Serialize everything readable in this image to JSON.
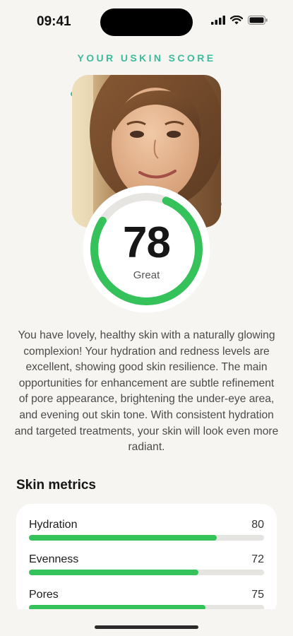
{
  "status_bar": {
    "time": "09:41"
  },
  "screen_title": "YOUR USKIN SCORE",
  "score": {
    "value": "78",
    "label": "Great",
    "progress": 0.78,
    "ring_color": "#36c25a"
  },
  "summary": "You have lovely, healthy skin with a naturally glowing complexion! Your hydration and redness levels are excellent, showing good skin resilience. The main opportunities for enhancement are subtle refinement of pore appearance, brightening the under-eye area, and evening out skin tone. With consistent hydration and targeted treatments, your skin will look even more radiant.",
  "metrics": {
    "heading": "Skin metrics",
    "items": [
      {
        "name": "Hydration",
        "value": "80"
      },
      {
        "name": "Evenness",
        "value": "72"
      },
      {
        "name": "Pores",
        "value": "75"
      }
    ]
  },
  "colors": {
    "accent_teal": "#3dbb9c",
    "bar_green": "#36c25a",
    "marker_coral": "#ee8b6c"
  }
}
